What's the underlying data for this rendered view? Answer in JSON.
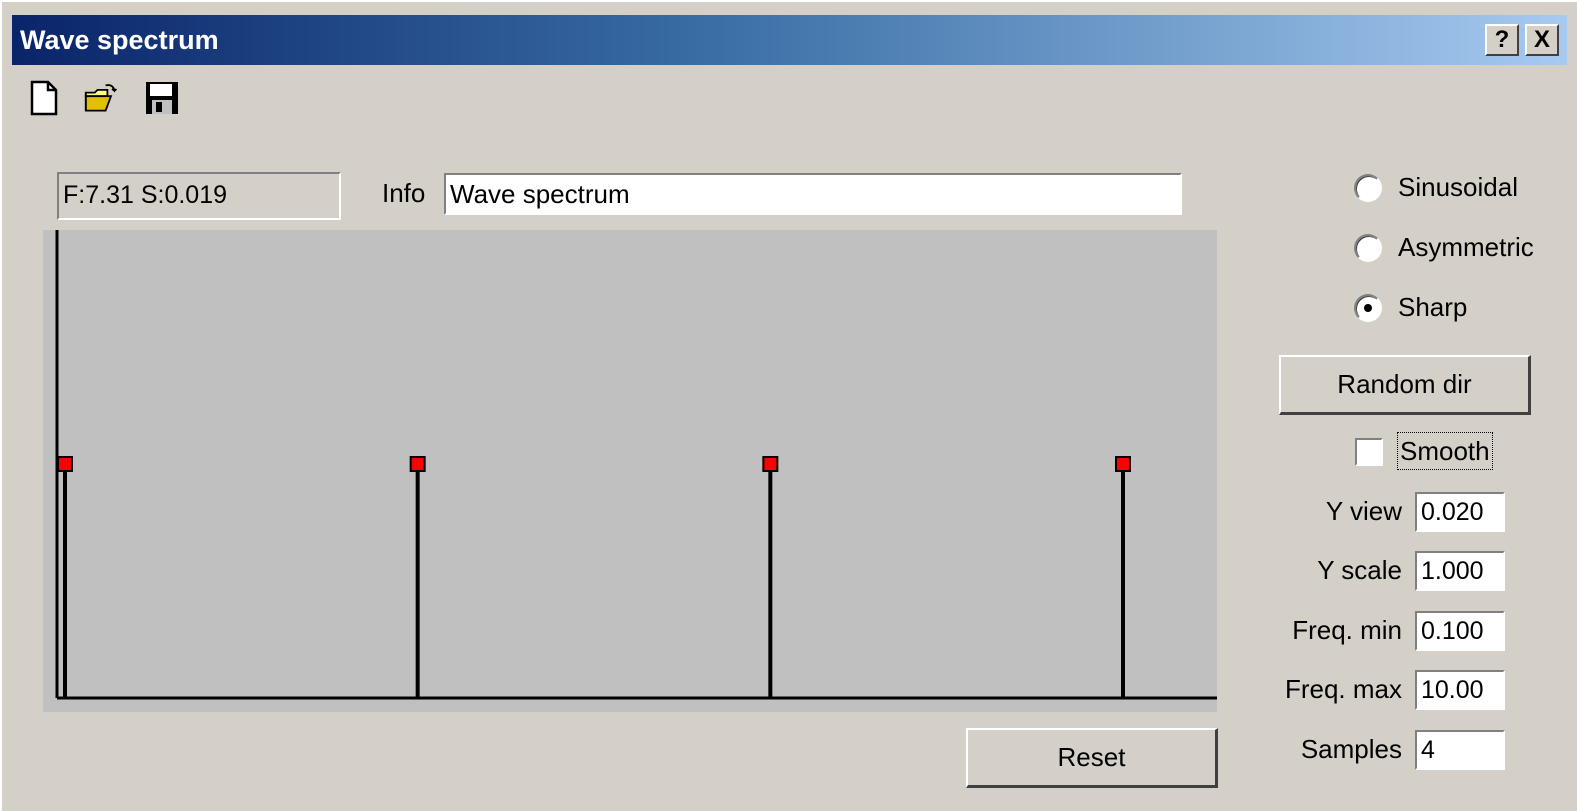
{
  "window": {
    "title": "Wave spectrum",
    "help_label": "?",
    "close_label": "X"
  },
  "toolbar": {
    "icons": [
      "new-file-icon",
      "open-folder-icon",
      "save-disk-icon"
    ]
  },
  "status": {
    "text": "F:7.31 S:0.019"
  },
  "info": {
    "label": "Info",
    "value": "Wave spectrum"
  },
  "chart_data": {
    "type": "bar",
    "title": "",
    "xlabel": "",
    "ylabel": "",
    "x": [
      0.1,
      3.4,
      6.7,
      10.0
    ],
    "values": [
      0.01,
      0.01,
      0.01,
      0.01
    ],
    "xlim": [
      0.1,
      10.0
    ],
    "ylim": [
      0,
      0.02
    ],
    "colors": {
      "stem": "#000000",
      "marker": "#ff0000",
      "background": "#c0c0c0"
    }
  },
  "wave_type": {
    "options": [
      "Sinusoidal",
      "Asymmetric",
      "Sharp"
    ],
    "selected": "Sharp"
  },
  "buttons": {
    "random_dir": "Random dir",
    "reset": "Reset"
  },
  "smooth": {
    "label": "Smooth",
    "checked": false
  },
  "params": [
    {
      "label": "Y view",
      "value": "0.020"
    },
    {
      "label": "Y scale",
      "value": "1.000"
    },
    {
      "label": "Freq. min",
      "value": "0.100"
    },
    {
      "label": "Freq. max",
      "value": "10.00"
    },
    {
      "label": "Samples",
      "value": "4"
    }
  ]
}
